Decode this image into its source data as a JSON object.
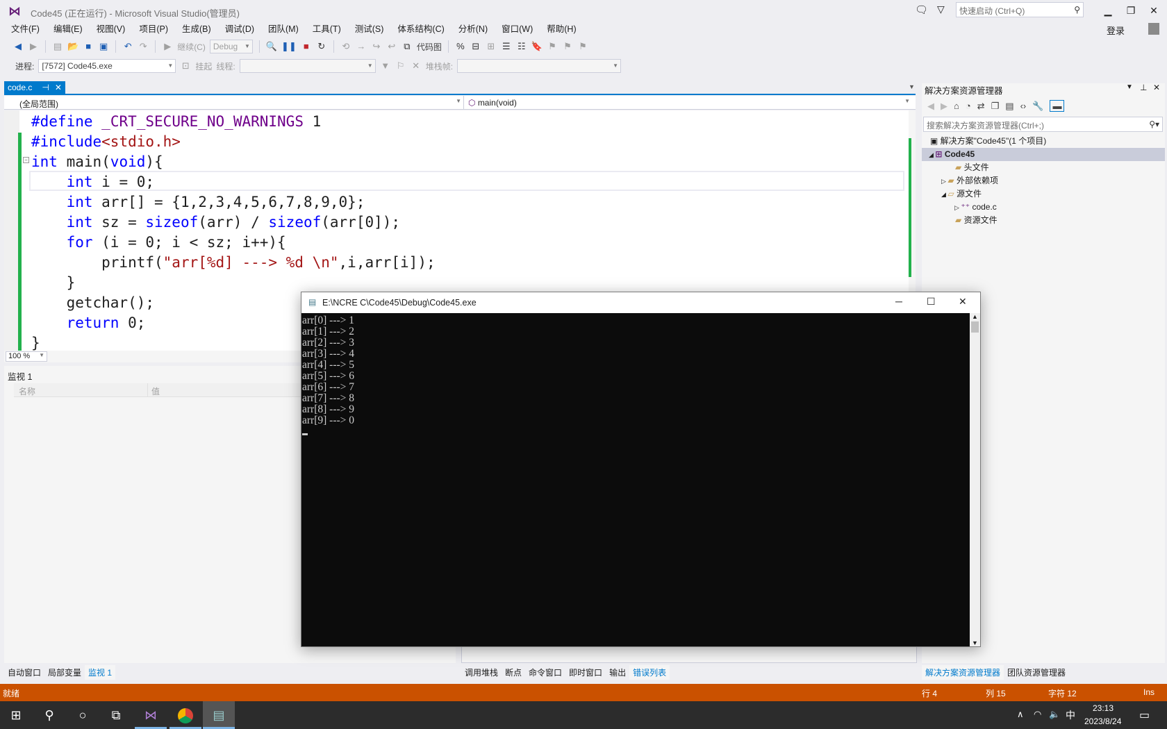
{
  "window": {
    "title": "Code45 (正在运行) - Microsoft Visual Studio(管理员)",
    "quick_launch": "快速启动 (Ctrl+Q)",
    "sign_in": "登录"
  },
  "menu": [
    "文件(F)",
    "编辑(E)",
    "视图(V)",
    "项目(P)",
    "生成(B)",
    "调试(D)",
    "团队(M)",
    "工具(T)",
    "测试(S)",
    "体系结构(C)",
    "分析(N)",
    "窗口(W)",
    "帮助(H)"
  ],
  "toolbar": {
    "continue": "继续(C)",
    "config": "Debug",
    "codemap": "代码图",
    "process_label": "进程:",
    "process": "[7572] Code45.exe",
    "suspend": "挂起",
    "thread_label": "线程:",
    "stackframe_label": "堆栈帧:"
  },
  "editor": {
    "tab": "code.c",
    "scope": "(全局范围)",
    "member": "main(void)",
    "zoom": "100 %"
  },
  "watch": {
    "title": "监视 1",
    "col_name": "名称",
    "col_value": "值"
  },
  "bottom_tabs_left": [
    "自动窗口",
    "局部变量",
    "监视 1"
  ],
  "bottom_tabs_mid": [
    "调用堆栈",
    "断点",
    "命令窗口",
    "即时窗口",
    "输出",
    "错误列表"
  ],
  "solution": {
    "title": "解决方案资源管理器",
    "search": "搜索解决方案资源管理器(Ctrl+;)",
    "root": "解决方案\"Code45\"(1 个项目)",
    "project": "Code45",
    "items": [
      "头文件",
      "外部依赖项",
      "源文件",
      "code.c",
      "资源文件"
    ],
    "tabs": [
      "解决方案资源管理器",
      "团队资源管理器"
    ]
  },
  "status": {
    "ready": "就绪",
    "line": "行 4",
    "col": "列 15",
    "char": "字符 12",
    "mode": "Ins"
  },
  "console": {
    "title": "E:\\NCRE C\\Code45\\Debug\\Code45.exe",
    "output": "arr[0] ---> 1\narr[1] ---> 2\narr[2] ---> 3\narr[3] ---> 4\narr[4] ---> 5\narr[5] ---> 6\narr[6] ---> 7\narr[7] ---> 8\narr[8] ---> 9\narr[9] ---> 0"
  },
  "taskbar": {
    "time": "23:13",
    "date": "2023/8/24",
    "ime": "中"
  },
  "colors": {
    "accent": "#007ACC",
    "status": "#CA5100"
  }
}
